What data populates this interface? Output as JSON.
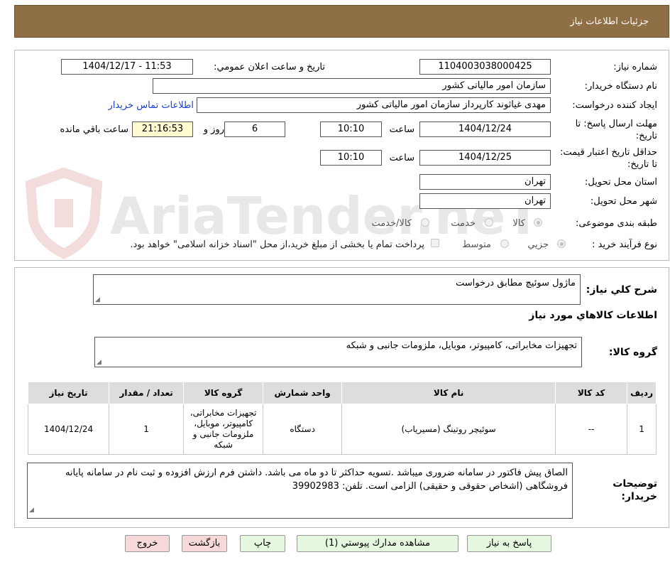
{
  "header": {
    "title": "جزئیات اطلاعات نیاز"
  },
  "watermark": {
    "text": "AriaTender.neT"
  },
  "form": {
    "need_number_label": "شماره نیاز:",
    "need_number": "1104003038000425",
    "announce_label": "تاریخ و ساعت اعلان عمومي:",
    "announce_value": "1404/12/17 - 11:53",
    "buyer_org_label": "نام دستگاه خریدار:",
    "buyer_org": "سازمان امور مالیاتی کشور",
    "requester_label": "ایجاد کننده درخواست:",
    "requester": "مهدی غیاثوند کارپرداز سازمان امور مالیاتی کشور",
    "contact_link": "اطلاعات تماس خریدار",
    "deadline_label": "مهلت ارسال پاسخ: تا تاریخ:",
    "deadline_date": "1404/12/24",
    "time_label": "ساعت",
    "deadline_time": "10:10",
    "days_value": "6",
    "days_label": "روز و",
    "remaining_time": "21:16:53",
    "remaining_label": "ساعت باقي مانده",
    "validity_label": "حداقل تاریخ اعتبار قیمت: تا تاریخ:",
    "validity_date": "1404/12/25",
    "validity_time": "10:10",
    "province_label": "استان محل تحویل:",
    "province": "تهران",
    "city_label": "شهر محل تحویل:",
    "city": "تهران",
    "category_label": "طبقه بندی موضوعی:",
    "category_options": [
      "کالا",
      "خدمت",
      "کالا/خدمت"
    ],
    "process_label": "نوع فرآیند خرید :",
    "process_options": [
      "جزیي",
      "متوسط"
    ],
    "payment_note": "پرداخت تمام یا بخشی از مبلغ خرید،از محل \"اسناد خزانه اسلامی\" خواهد بود."
  },
  "summary": {
    "description_label": "شرح کلي نیاز:",
    "description": "ماژول سوئیچ مطابق درخواست",
    "goods_info_title": "اطلاعات کالاهاي مورد نیاز",
    "goods_group_label": "گروه کالا:",
    "goods_group": "تجهیزات مخابراتی، کامپیوتر، موبایل، ملزومات جانبی و شبکه"
  },
  "table": {
    "headers": [
      "ردیف",
      "کد کالا",
      "نام کالا",
      "واحد شمارش",
      "گروه کالا",
      "تعداد / مقدار",
      "تاریخ نیاز"
    ],
    "rows": [
      [
        "1",
        "--",
        "سوئیچر روتینگ (مسیریاب)",
        "دستگاه",
        "تجهیزات مخابراتی، کامپیوتر، موبایل، ملزومات جانبی و شبکه",
        "1",
        "1404/12/24"
      ]
    ]
  },
  "buyer_notes": {
    "label": "توضیحات خریدار:",
    "text": "الصاق پیش فاکتور در سامانه ضروری میباشد .تسویه حداکثر تا دو ماه می باشد.  داشتن فرم ارزش افزوده و ثبت نام در سامانه پایانه فروشگاهی (اشخاص حقوقی و حقیقی) الزامی است. تلفن: 39902983"
  },
  "buttons": {
    "reply": "پاسخ به نیاز",
    "attachments": "مشاهده مدارك پيوستي (1)",
    "print": "چاپ",
    "back": "بازگشت",
    "exit": "خروج"
  },
  "colors": {
    "header_bg": "#8f6f45",
    "yellow_box": "#fffbd0",
    "link": "#1a3fd6",
    "green_btn": "#e6f7df",
    "red_btn": "#f7d9d9"
  }
}
